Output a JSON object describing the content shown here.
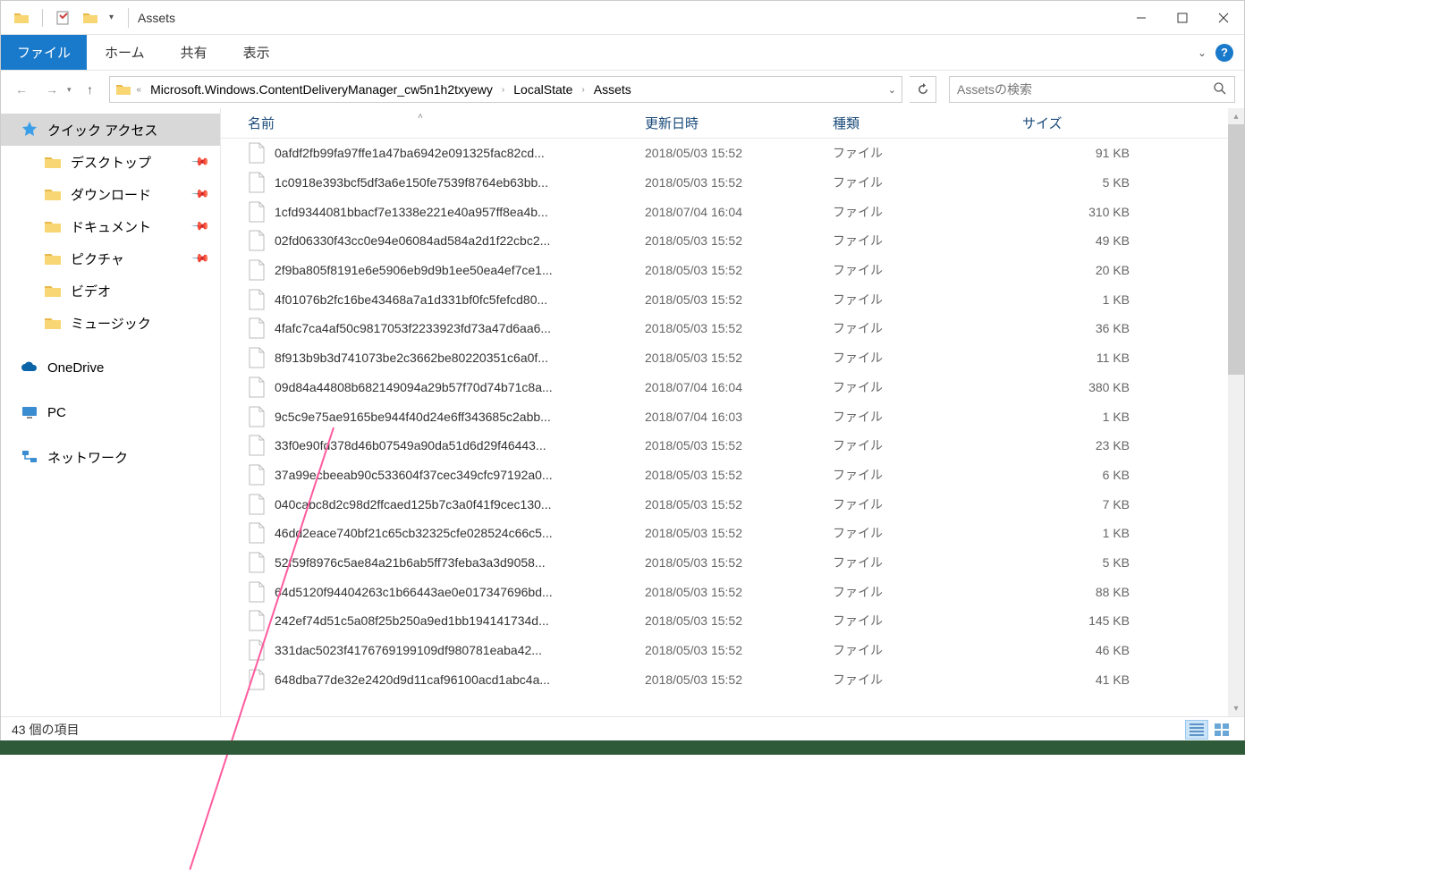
{
  "window_title": "Assets",
  "ribbon": {
    "file_tab": "ファイル",
    "tabs": [
      "ホーム",
      "共有",
      "表示"
    ]
  },
  "breadcrumb": {
    "leading_sep": "«",
    "items": [
      "Microsoft.Windows.ContentDeliveryManager_cw5n1h2txyewy",
      "LocalState",
      "Assets"
    ]
  },
  "search_placeholder": "Assetsの検索",
  "sidebar": {
    "quick_access": "クイック アクセス",
    "desktop": "デスクトップ",
    "downloads": "ダウンロード",
    "documents": "ドキュメント",
    "pictures": "ピクチャ",
    "videos": "ビデオ",
    "music": "ミュージック",
    "onedrive": "OneDrive",
    "pc": "PC",
    "network": "ネットワーク"
  },
  "columns": {
    "name": "名前",
    "date": "更新日時",
    "type": "種類",
    "size": "サイズ"
  },
  "file_type_label": "ファイル",
  "files": [
    {
      "name": "0afdf2fb99fa97ffe1a47ba6942e091325fac82cd...",
      "date": "2018/05/03 15:52",
      "size": "91 KB"
    },
    {
      "name": "1c0918e393bcf5df3a6e150fe7539f8764eb63bb...",
      "date": "2018/05/03 15:52",
      "size": "5 KB"
    },
    {
      "name": "1cfd9344081bbacf7e1338e221e40a957ff8ea4b...",
      "date": "2018/07/04 16:04",
      "size": "310 KB"
    },
    {
      "name": "02fd06330f43cc0e94e06084ad584a2d1f22cbc2...",
      "date": "2018/05/03 15:52",
      "size": "49 KB"
    },
    {
      "name": "2f9ba805f8191e6e5906eb9d9b1ee50ea4ef7ce1...",
      "date": "2018/05/03 15:52",
      "size": "20 KB"
    },
    {
      "name": "4f01076b2fc16be43468a7a1d331bf0fc5fefcd80...",
      "date": "2018/05/03 15:52",
      "size": "1 KB"
    },
    {
      "name": "4fafc7ca4af50c9817053f2233923fd73a47d6aa6...",
      "date": "2018/05/03 15:52",
      "size": "36 KB"
    },
    {
      "name": "8f913b9b3d741073be2c3662be80220351c6a0f...",
      "date": "2018/05/03 15:52",
      "size": "11 KB"
    },
    {
      "name": "09d84a44808b682149094a29b57f70d74b71c8a...",
      "date": "2018/07/04 16:04",
      "size": "380 KB"
    },
    {
      "name": "9c5c9e75ae9165be944f40d24e6ff343685c2abb...",
      "date": "2018/07/04 16:03",
      "size": "1 KB"
    },
    {
      "name": "33f0e90fd378d46b07549a90da51d6d29f46443...",
      "date": "2018/05/03 15:52",
      "size": "23 KB"
    },
    {
      "name": "37a99ecbeeab90c533604f37cec349cfc97192a0...",
      "date": "2018/05/03 15:52",
      "size": "6 KB"
    },
    {
      "name": "040cabc8d2c98d2ffcaed125b7c3a0f41f9cec130...",
      "date": "2018/05/03 15:52",
      "size": "7 KB"
    },
    {
      "name": "46dd2eace740bf21c65cb32325cfe028524c66c5...",
      "date": "2018/05/03 15:52",
      "size": "1 KB"
    },
    {
      "name": "52f59f8976c5ae84a21b6ab5ff73feba3a3d9058...",
      "date": "2018/05/03 15:52",
      "size": "5 KB"
    },
    {
      "name": "64d5120f94404263c1b66443ae0e017347696bd...",
      "date": "2018/05/03 15:52",
      "size": "88 KB"
    },
    {
      "name": "242ef74d51c5a08f25b250a9ed1bb194141734d...",
      "date": "2018/05/03 15:52",
      "size": "145 KB"
    },
    {
      "name": "331dac5023f4176769199109df980781eaba42...",
      "date": "2018/05/03 15:52",
      "size": "46 KB"
    },
    {
      "name": "648dba77de32e2420d9d11caf96100acd1abc4a...",
      "date": "2018/05/03 15:52",
      "size": "41 KB"
    }
  ],
  "status_text": "43 個の項目"
}
